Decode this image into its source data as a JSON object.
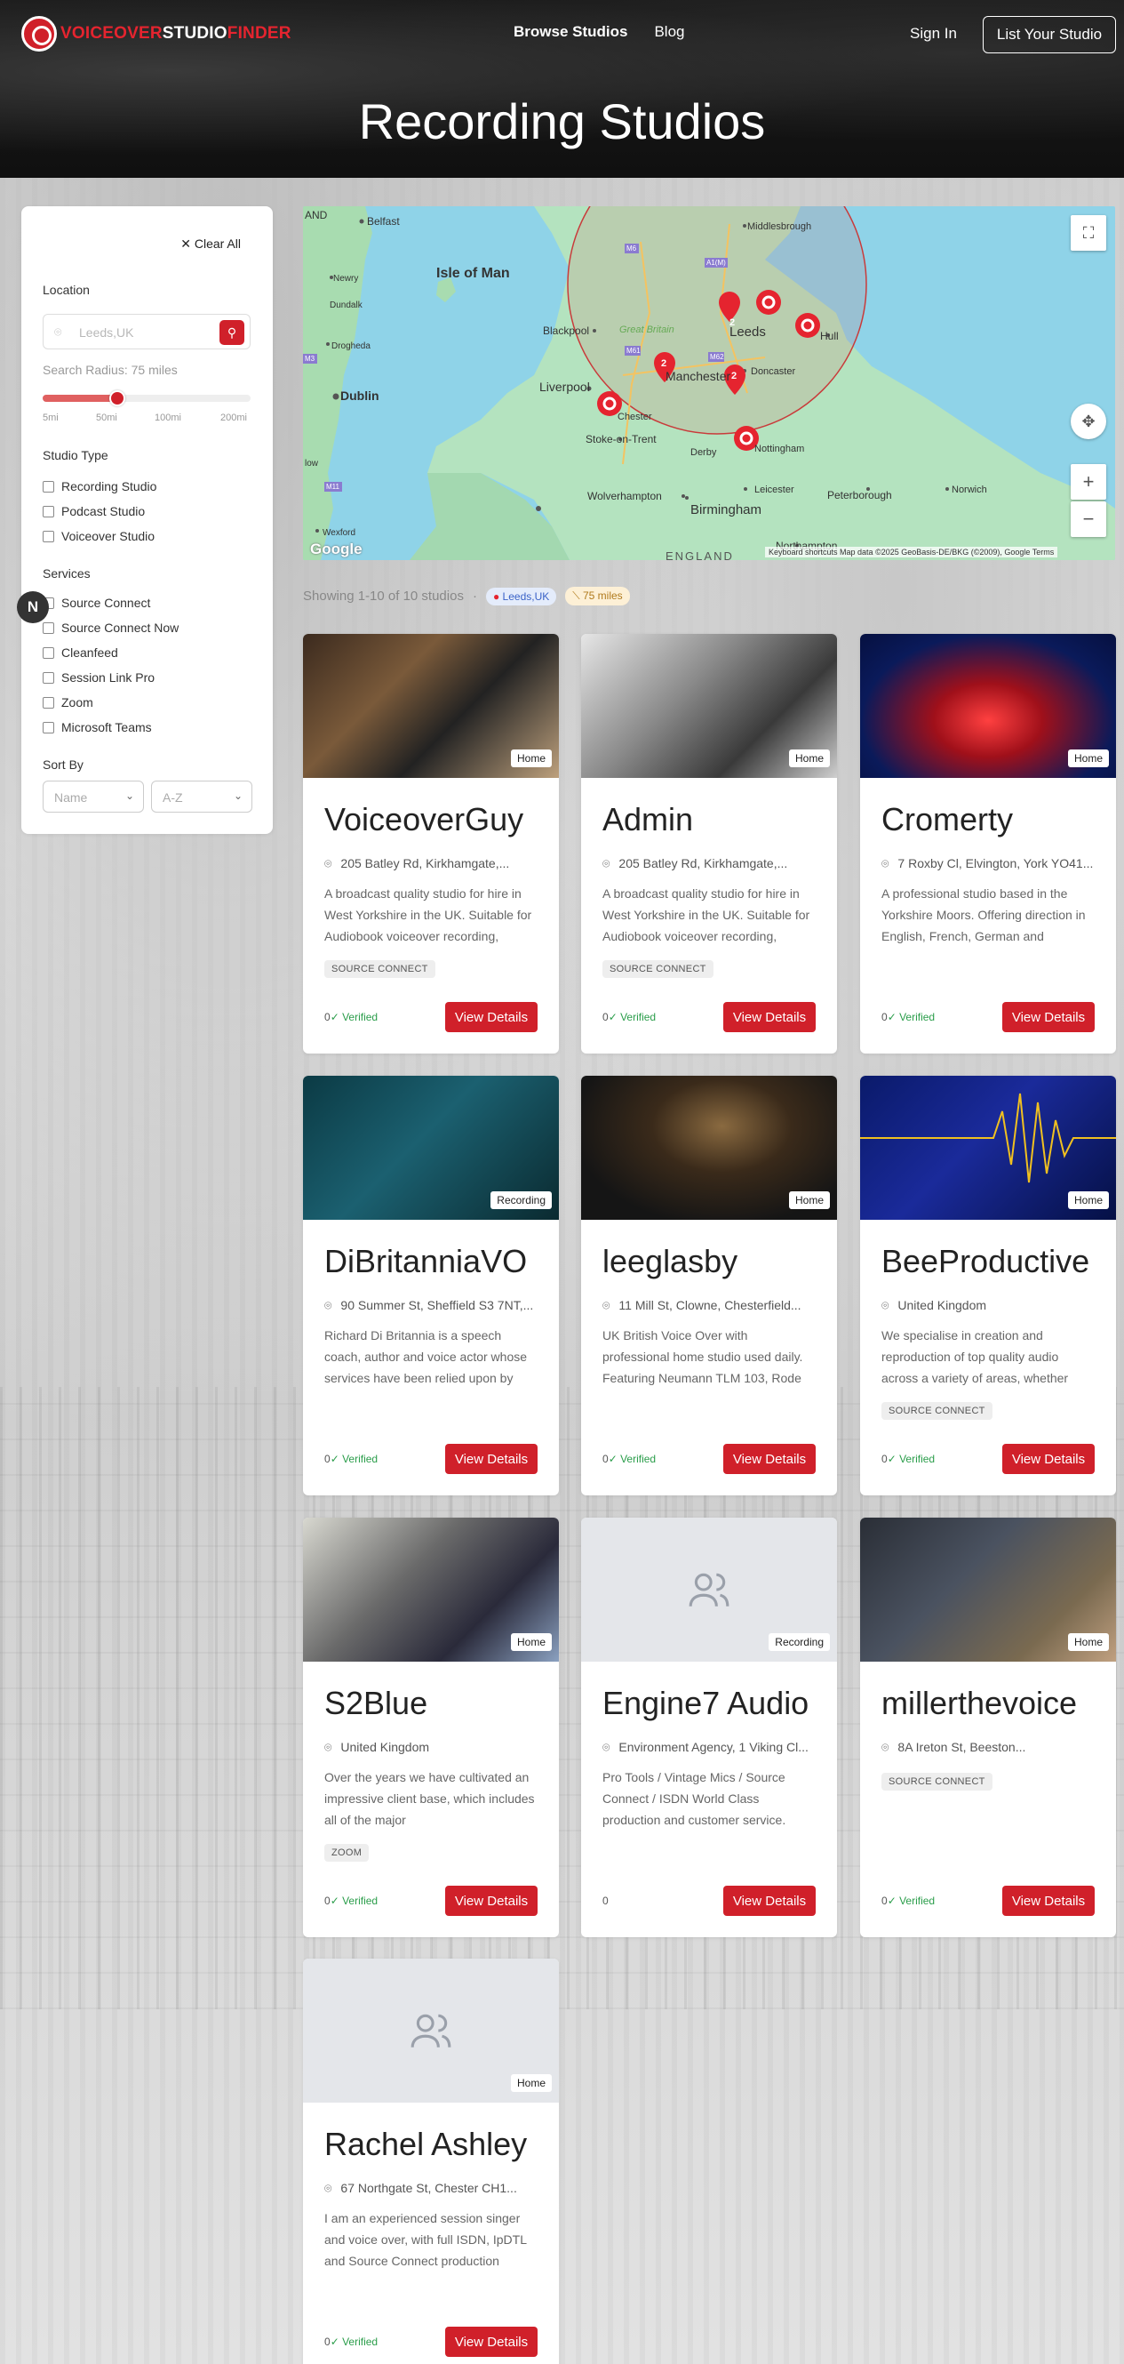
{
  "header": {
    "logo": {
      "part1": "VOICEOVER",
      "part2": "STUDIO",
      "part3": "FINDER"
    },
    "nav": [
      "Browse Studios",
      "Blog"
    ],
    "signin": "Sign In",
    "list_studio": "List Your Studio",
    "title": "Recording Studios"
  },
  "filters": {
    "clear_all": "Clear All",
    "location_label": "Location",
    "location_placeholder": "Leeds,UK",
    "radius_text": "Search Radius: 75 miles",
    "radius_value_miles": 75,
    "radius_max_miles": 200,
    "ticks": [
      "5mi",
      "50mi",
      "100mi",
      "200mi"
    ],
    "studio_type_label": "Studio Type",
    "studio_types": [
      "Recording Studio",
      "Podcast Studio",
      "Voiceover Studio"
    ],
    "services_label": "Services",
    "services": [
      "Source Connect",
      "Source Connect Now",
      "Cleanfeed",
      "Session Link Pro",
      "Zoom",
      "Microsoft Teams"
    ],
    "sort_label": "Sort By",
    "sort_field": "Name",
    "sort_order": "A-Z",
    "floating_badge": "N"
  },
  "map": {
    "labels": [
      "AND",
      "Belfast",
      "Newry",
      "Dundalk",
      "Drogheda",
      "Dublin",
      "Isle of Man",
      "Middlesbrough",
      "Blackpool",
      "Leeds",
      "Hull",
      "Liverpool",
      "Manchester",
      "Doncaster",
      "Chester",
      "Stoke-on-Trent",
      "Derby",
      "Nottingham",
      "Leicester",
      "Peterborough",
      "Norwich",
      "Wolverhampton",
      "Birmingham",
      "Northampton",
      "Wexford",
      "Great Britain",
      "ENGLAND",
      "low"
    ],
    "road_labels": [
      "M6",
      "A1(M)",
      "M62",
      "M61",
      "M3",
      "M11"
    ],
    "cluster_counts": [
      "2",
      "2",
      "2"
    ],
    "footer": "Keyboard shortcuts   Map data ©2025 GeoBasis-DE/BKG (©2009), Google   Terms",
    "google": "Google"
  },
  "showing": {
    "text": "Showing 1-10 of 10 studios",
    "dot": "·",
    "location_chip": "Leeds,UK",
    "radius_chip": "75 miles"
  },
  "studios": [
    {
      "name": "VoiceoverGuy",
      "tag": "Home",
      "address": "205 Batley Rd, Kirkhamgate,...",
      "description": "A broadcast quality studio for hire in West Yorkshire in the UK. Suitable for Audiobook voiceover recording,",
      "service": "SOURCE CONNECT",
      "rating": "0",
      "verified": "✓ Verified",
      "button": "View Details"
    },
    {
      "name": "Admin",
      "tag": "Home",
      "address": "205 Batley Rd, Kirkhamgate,...",
      "description": "A broadcast quality studio for hire in West Yorkshire in the UK. Suitable for Audiobook voiceover recording,",
      "service": "SOURCE CONNECT",
      "rating": "0",
      "verified": "✓ Verified",
      "button": "View Details"
    },
    {
      "name": "Cromerty",
      "tag": "Home",
      "address": "7 Roxby Cl, Elvington, York YO41...",
      "description": "A professional studio based in the Yorkshire Moors. Offering direction in English, French, German and",
      "service": "",
      "rating": "0",
      "verified": "✓ Verified",
      "button": "View Details"
    },
    {
      "name": "DiBritanniaVO",
      "tag": "Recording",
      "address": "90 Summer St, Sheffield S3 7NT,...",
      "description": "Richard Di Britannia is a speech coach, author and voice actor whose services have been relied upon by",
      "service": "",
      "rating": "0",
      "verified": "✓ Verified",
      "button": "View Details"
    },
    {
      "name": "leeglasby",
      "tag": "Home",
      "address": "11 Mill St, Clowne, Chesterfield...",
      "description": "UK British Voice Over with professional home studio used daily. Featuring Neumann TLM 103, Rode",
      "service": "",
      "rating": "0",
      "verified": "✓ Verified",
      "button": "View Details"
    },
    {
      "name": "BeeProductive",
      "tag": "Home",
      "address": "United Kingdom",
      "description": "We specialise in creation and reproduction of top quality audio across a variety of areas, whether",
      "service": "SOURCE CONNECT",
      "rating": "0",
      "verified": "✓ Verified",
      "button": "View Details"
    },
    {
      "name": "S2Blue",
      "tag": "Home",
      "address": "United Kingdom",
      "description": "Over the years we have cultivated an impressive client base, which includes all of the major",
      "service": "ZOOM",
      "rating": "0",
      "verified": "✓ Verified",
      "button": "View Details"
    },
    {
      "name": "Engine7 Audio",
      "tag": "Recording",
      "address": "Environment Agency, 1 Viking Cl...",
      "description": "Pro Tools / Vintage Mics / Source Connect / ISDN World Class production and customer service.",
      "service": "",
      "rating": "0",
      "verified": "",
      "button": "View Details"
    },
    {
      "name": "millerthevoice",
      "tag": "Home",
      "address": "8A Ireton St, Beeston...",
      "description": "",
      "service": "SOURCE CONNECT",
      "rating": "0",
      "verified": "✓ Verified",
      "button": "View Details"
    },
    {
      "name": "Rachel Ashley",
      "tag": "Home",
      "address": "67 Northgate St, Chester CH1...",
      "description": "I am an experienced session singer and voice over, with full ISDN, IpDTL and Source Connect production",
      "service": "",
      "rating": "0",
      "verified": "✓ Verified",
      "button": "View Details"
    }
  ],
  "colors": {
    "accent": "#d0202a",
    "verified": "#2a9d4a",
    "header_bg": "#141414"
  }
}
